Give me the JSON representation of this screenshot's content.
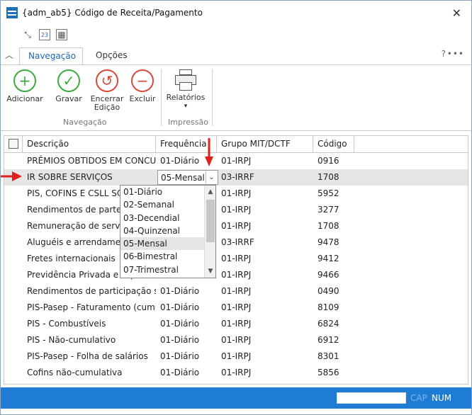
{
  "window": {
    "title": "{adm_ab5}  Código de Receita/Pagamento"
  },
  "ribbon": {
    "tabs": [
      {
        "label": "Navegação"
      },
      {
        "label": "Opções"
      }
    ],
    "help": "?",
    "more": "•••",
    "buttons": {
      "adicionar": "Adicionar",
      "gravar": "Gravar",
      "encerrar_1": "Encerrar",
      "encerrar_2": "Edição",
      "excluir": "Excluir",
      "relatorios": "Relatórios"
    },
    "groups": {
      "navegacao": "Navegação",
      "impressao": "Impressão"
    }
  },
  "grid": {
    "columns": [
      "Descrição",
      "Frequência",
      "Grupo MIT/DCTF",
      "Código"
    ],
    "rows": [
      {
        "descricao": "PRÊMIOS OBTIDOS EM CONCUR...",
        "frequencia": "01-Diário",
        "grupo": "01-IRPJ",
        "codigo": "0916"
      },
      {
        "descricao": "IR SOBRE SERVIÇOS",
        "frequencia": "05-Mensal",
        "grupo": "03-IRRF",
        "codigo": "1708"
      },
      {
        "descricao": "PIS, COFINS E CSLL SOBRE",
        "frequencia": "",
        "grupo": "01-IRPJ",
        "codigo": "5952"
      },
      {
        "descricao": "Rendimentos de partes be",
        "frequencia": "",
        "grupo": "01-IRPJ",
        "codigo": "3277"
      },
      {
        "descricao": "Remuneração de serviços",
        "frequencia": "",
        "grupo": "01-IRPJ",
        "codigo": "1708"
      },
      {
        "descricao": "Aluguéis e arrendamento",
        "frequencia": "",
        "grupo": "03-IRRF",
        "codigo": "9478"
      },
      {
        "descricao": "Fretes internacionais",
        "frequencia": "",
        "grupo": "01-IRPJ",
        "codigo": "9412"
      },
      {
        "descricao": "Previdência Privada e Fap",
        "frequencia": "",
        "grupo": "01-IRPJ",
        "codigo": "9466"
      },
      {
        "descricao": "Rendimentos de participação so...",
        "frequencia": "01-Diário",
        "grupo": "01-IRPJ",
        "codigo": "0490"
      },
      {
        "descricao": "PIS-Pasep - Faturamento (cumul...",
        "frequencia": "01-Diário",
        "grupo": "01-IRPJ",
        "codigo": "8109"
      },
      {
        "descricao": "PIS - Combustíveis",
        "frequencia": "01-Diário",
        "grupo": "01-IRPJ",
        "codigo": "6824"
      },
      {
        "descricao": "PIS - Não-cumulativo",
        "frequencia": "01-Diário",
        "grupo": "01-IRPJ",
        "codigo": "6912"
      },
      {
        "descricao": "PIS-Pasep - Folha de salários",
        "frequencia": "01-Diário",
        "grupo": "01-IRPJ",
        "codigo": "8301"
      },
      {
        "descricao": "Cofins não-cumulativa",
        "frequencia": "01-Diário",
        "grupo": "01-IRPJ",
        "codigo": "5856"
      }
    ],
    "dropdown_options": [
      "01-Diário",
      "02-Semanal",
      "03-Decendial",
      "04-Quinzenal",
      "05-Mensal",
      "06-Bimestral",
      "07-Trimestral"
    ],
    "dropdown_selected": "05-Mensal"
  },
  "status": {
    "cap": "CAP",
    "num": "NUM"
  },
  "colors": {
    "accent": "#1f7cd5",
    "arrow": "#e0201b",
    "green": "#3caa3c",
    "red": "#d64a3a"
  }
}
